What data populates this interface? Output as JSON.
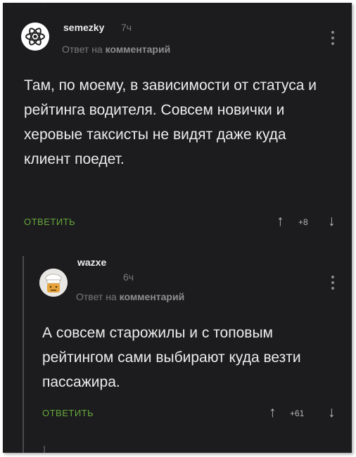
{
  "comments": [
    {
      "username": "semezky",
      "time": "7ч",
      "reply_prefix": "Ответ на",
      "reply_target": "комментарий",
      "text": "Там, по моему, в зависимости от статуса и рейтинга водителя. Совсем новички и херовые таксисты не видят даже куда клиент поедет.",
      "reply_label": "ОТВЕТИТЬ",
      "rating": "+8",
      "avatar_icon": "atom-icon",
      "accent_color": "#66a83b"
    },
    {
      "username": "wazxe",
      "time": "6ч",
      "reply_prefix": "Ответ на",
      "reply_target": "комментарий",
      "text": "А совсем старожилы и с топовым рейтингом сами выбирают куда везти пассажира.",
      "reply_label": "ОТВЕТИТЬ",
      "rating": "+61",
      "avatar_icon": "chef-icon",
      "accent_color": "#66a83b"
    }
  ],
  "icons": {
    "upvote": "↑",
    "downvote": "↓",
    "menu": "kebab-menu-icon"
  }
}
